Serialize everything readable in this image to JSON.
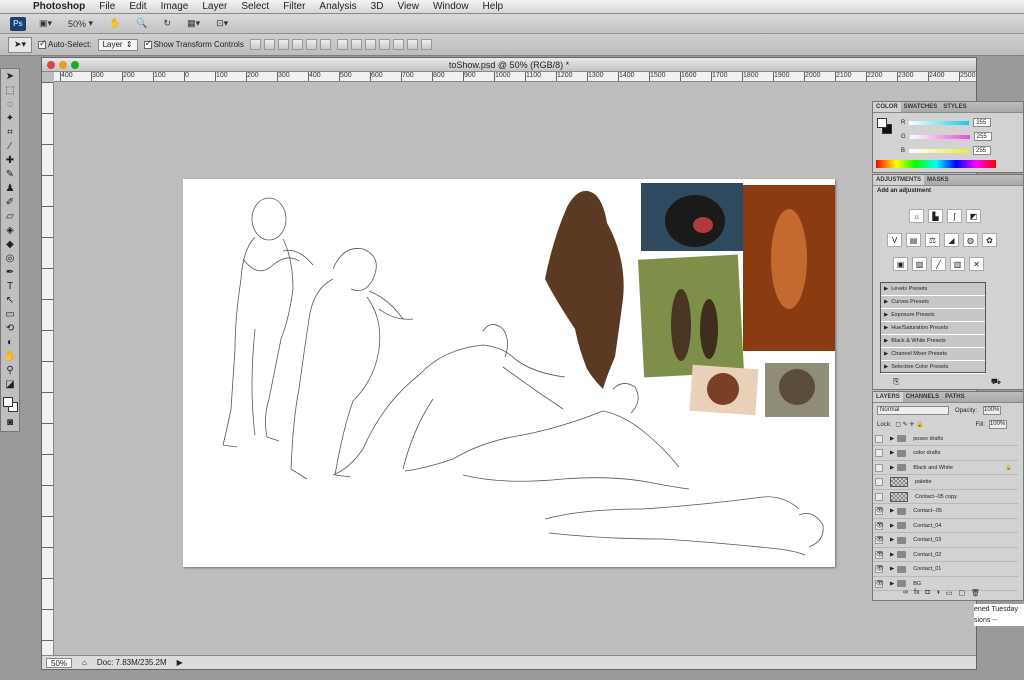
{
  "menubar": {
    "apple": "",
    "items": [
      "Photoshop",
      "File",
      "Edit",
      "Image",
      "Layer",
      "Select",
      "Filter",
      "Analysis",
      "3D",
      "View",
      "Window",
      "Help"
    ]
  },
  "appbar": {
    "logo": "Ps",
    "zoom": "50%"
  },
  "optbar": {
    "auto_select_label": "Auto-Select:",
    "auto_select_value": "Layer",
    "show_transform_label": "Show Transform Controls"
  },
  "document": {
    "title": "toShow.psd @ 50% (RGB/8) *",
    "ruler_labels": [
      "400",
      "300",
      "200",
      "100",
      "0",
      "100",
      "200",
      "300",
      "400",
      "500",
      "600",
      "700",
      "800",
      "900",
      "1000",
      "1100",
      "1200",
      "1300",
      "1400",
      "1500",
      "1600",
      "1700",
      "1800",
      "1900",
      "2000",
      "2100",
      "2200",
      "2300",
      "2400",
      "2500"
    ],
    "zoom": "50%",
    "doc_info": "Doc: 7.83M/235.2M"
  },
  "color_panel": {
    "tabs": [
      "COLOR",
      "SWATCHES",
      "STYLES"
    ],
    "sliders": [
      {
        "label": "R",
        "value": "255",
        "color": "#19c9e8"
      },
      {
        "label": "G",
        "value": "255",
        "color": "#e84ad8"
      },
      {
        "label": "B",
        "value": "255",
        "color": "#e8e83a"
      }
    ]
  },
  "adjustments_panel": {
    "tabs": [
      "ADJUSTMENTS",
      "MASKS"
    ],
    "title": "Add an adjustment",
    "presets": [
      "Levels Presets",
      "Curves Presets",
      "Exposure Presets",
      "Hue/Saturation Presets",
      "Black & White Presets",
      "Channel Mixer Presets",
      "Selective Color Presets"
    ]
  },
  "layers_panel": {
    "tabs": [
      "LAYERS",
      "CHANNELS",
      "PATHS"
    ],
    "blend_mode": "Normal",
    "opacity_label": "Opacity:",
    "opacity_value": "100%",
    "lock_label": "Lock:",
    "fill_label": "Fill:",
    "fill_value": "100%",
    "layers": [
      {
        "name": "poses drafts",
        "type": "folder",
        "visible": false
      },
      {
        "name": "color drafts",
        "type": "folder",
        "visible": false
      },
      {
        "name": "Black and White",
        "type": "folder",
        "visible": false,
        "locked": true
      },
      {
        "name": "palette",
        "type": "layer",
        "visible": false
      },
      {
        "name": "Contact--05 copy",
        "type": "layer",
        "visible": false
      },
      {
        "name": "Contact--05",
        "type": "folder",
        "visible": true
      },
      {
        "name": "Contact_04",
        "type": "folder",
        "visible": true
      },
      {
        "name": "Contact_03",
        "type": "folder",
        "visible": true
      },
      {
        "name": "Contact_02",
        "type": "folder",
        "visible": true
      },
      {
        "name": "Contact_01",
        "type": "folder",
        "visible": true
      },
      {
        "name": "BG",
        "type": "folder",
        "visible": true
      }
    ]
  },
  "partial_window": {
    "line1": "ened  Tuesday",
    "line2": "sions  --"
  }
}
